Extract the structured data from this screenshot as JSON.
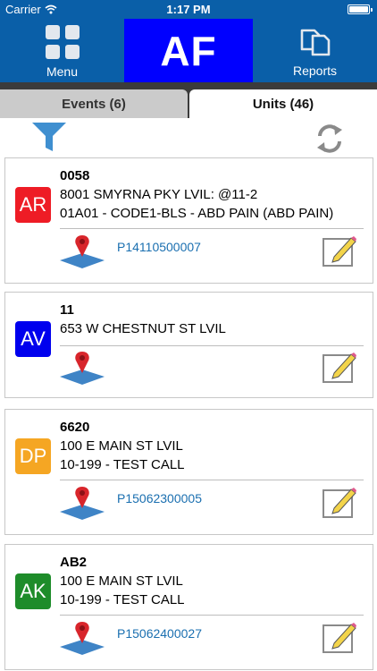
{
  "status_bar": {
    "carrier": "Carrier",
    "time": "1:17 PM"
  },
  "nav": {
    "menu_label": "Menu",
    "center_label": "AF",
    "reports_label": "Reports",
    "center_color": "#0000ff",
    "bar_color": "#0a5fa8"
  },
  "tabs": {
    "events": "Events (6)",
    "units": "Units (46)"
  },
  "units": [
    {
      "badge": "AR",
      "badge_color": "#ee1c25",
      "unit": "0058",
      "address": "8001 SMYRNA PKY LVIL: @11-2",
      "call": "01A01 - CODE1-BLS - ABD PAIN (ABD PAIN)",
      "event_id": "P14110500007"
    },
    {
      "badge": "AV",
      "badge_color": "#0000ee",
      "unit": "11",
      "address": "653 W CHESTNUT ST LVIL",
      "call": "",
      "event_id": ""
    },
    {
      "badge": "DP",
      "badge_color": "#f5a623",
      "unit": "6620",
      "address": "100 E MAIN ST LVIL",
      "call": "10-199 - TEST CALL",
      "event_id": "P15062300005"
    },
    {
      "badge": "AK",
      "badge_color": "#1e8c2a",
      "unit": "AB2",
      "address": "100 E MAIN ST LVIL",
      "call": "10-199 - TEST CALL",
      "event_id": "P15062400027"
    }
  ]
}
